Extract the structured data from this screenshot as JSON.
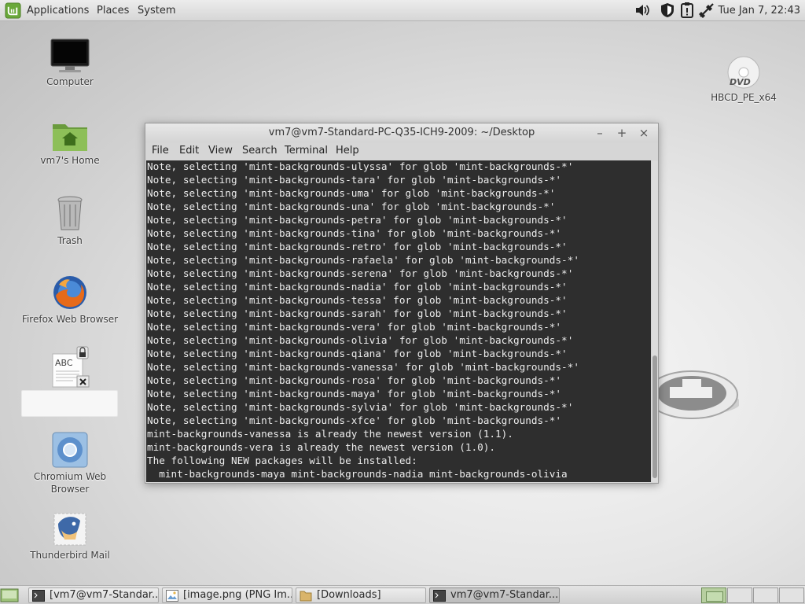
{
  "top_panel": {
    "menus": [
      "Applications",
      "Places",
      "System"
    ],
    "clock": "Tue Jan  7, 22:43",
    "tray_icons": [
      "volume-icon",
      "shield-icon",
      "update-notice-icon",
      "network-disconnected-icon"
    ]
  },
  "desktop": {
    "icons": [
      {
        "label": "Computer",
        "icon": "monitor-icon"
      },
      {
        "label": "vm7's Home",
        "icon": "home-folder-icon"
      },
      {
        "label": "Trash",
        "icon": "trash-icon"
      },
      {
        "label": "Firefox Web Browser",
        "icon": "firefox-icon"
      },
      {
        "label": "",
        "icon": "text-document-icon"
      },
      {
        "label": "Chromium Web Browser",
        "icon": "chromium-icon"
      },
      {
        "label": "Thunderbird Mail",
        "icon": "thunderbird-icon"
      },
      {
        "label": "HBCD_PE_x64",
        "icon": "dvd-icon"
      }
    ],
    "icon_text": "ABC"
  },
  "terminal": {
    "title": "vm7@vm7-Standard-PC-Q35-ICH9-2009: ~/Desktop",
    "menus": [
      "File",
      "Edit",
      "View",
      "Search",
      "Terminal",
      "Help"
    ],
    "lines": [
      "Note, selecting 'mint-backgrounds-ulyssa' for glob 'mint-backgrounds-*'",
      "Note, selecting 'mint-backgrounds-tara' for glob 'mint-backgrounds-*'",
      "Note, selecting 'mint-backgrounds-uma' for glob 'mint-backgrounds-*'",
      "Note, selecting 'mint-backgrounds-una' for glob 'mint-backgrounds-*'",
      "Note, selecting 'mint-backgrounds-petra' for glob 'mint-backgrounds-*'",
      "Note, selecting 'mint-backgrounds-tina' for glob 'mint-backgrounds-*'",
      "Note, selecting 'mint-backgrounds-retro' for glob 'mint-backgrounds-*'",
      "Note, selecting 'mint-backgrounds-rafaela' for glob 'mint-backgrounds-*'",
      "Note, selecting 'mint-backgrounds-serena' for glob 'mint-backgrounds-*'",
      "Note, selecting 'mint-backgrounds-nadia' for glob 'mint-backgrounds-*'",
      "Note, selecting 'mint-backgrounds-tessa' for glob 'mint-backgrounds-*'",
      "Note, selecting 'mint-backgrounds-sarah' for glob 'mint-backgrounds-*'",
      "Note, selecting 'mint-backgrounds-vera' for glob 'mint-backgrounds-*'",
      "Note, selecting 'mint-backgrounds-olivia' for glob 'mint-backgrounds-*'",
      "Note, selecting 'mint-backgrounds-qiana' for glob 'mint-backgrounds-*'",
      "Note, selecting 'mint-backgrounds-vanessa' for glob 'mint-backgrounds-*'",
      "Note, selecting 'mint-backgrounds-rosa' for glob 'mint-backgrounds-*'",
      "Note, selecting 'mint-backgrounds-maya' for glob 'mint-backgrounds-*'",
      "Note, selecting 'mint-backgrounds-sylvia' for glob 'mint-backgrounds-*'",
      "Note, selecting 'mint-backgrounds-xfce' for glob 'mint-backgrounds-*'",
      "mint-backgrounds-vanessa is already the newest version (1.1).",
      "mint-backgrounds-vera is already the newest version (1.0).",
      "The following NEW packages will be installed:",
      "  mint-backgrounds-maya mint-backgrounds-nadia mint-backgrounds-olivia"
    ]
  },
  "taskbar": {
    "tasks": [
      {
        "label": "[vm7@vm7-Standar...",
        "icon": "terminal-icon"
      },
      {
        "label": "[image.png (PNG Im...",
        "icon": "image-viewer-icon"
      },
      {
        "label": "[Downloads]",
        "icon": "folder-icon"
      },
      {
        "label": "vm7@vm7-Standar...",
        "icon": "terminal-icon",
        "active": true
      }
    ],
    "workspaces": 4,
    "active_workspace": 1
  }
}
